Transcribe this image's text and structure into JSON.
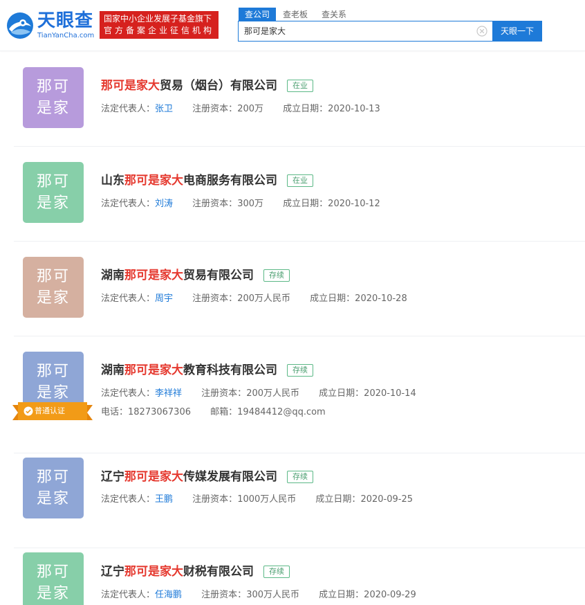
{
  "header": {
    "logo_cn": "天眼查",
    "logo_en": "TianYanCha.com",
    "gov_line1": "国家中小企业发展子基金旗下",
    "gov_line2": "官方备案企业征信机构",
    "tabs": [
      {
        "label": "查公司",
        "active": true
      },
      {
        "label": "查老板",
        "active": false
      },
      {
        "label": "查关系",
        "active": false
      }
    ],
    "search_value": "那可是家大",
    "search_button": "天眼一下",
    "brand_color": "#1e7ad8"
  },
  "labels": {
    "legal_rep": "法定代表人：",
    "capital": "注册资本：",
    "founded": "成立日期：",
    "phone": "电话：",
    "email": "邮箱：",
    "cert": "普通认证"
  },
  "results": [
    {
      "avatar_l1": "那可",
      "avatar_l2": "是家",
      "avatar_color": "#b79bdc",
      "name_pre": "",
      "name_hl": "那可是家大",
      "name_post": "贸易（烟台）有限公司",
      "status": "在业",
      "legal_rep": "张卫",
      "capital": "200万",
      "founded": "2020-10-13"
    },
    {
      "avatar_l1": "那可",
      "avatar_l2": "是家",
      "avatar_color": "#87cfa9",
      "name_pre": "山东",
      "name_hl": "那可是家大",
      "name_post": "电商服务有限公司",
      "status": "在业",
      "legal_rep": "刘涛",
      "capital": "300万",
      "founded": "2020-10-12"
    },
    {
      "avatar_l1": "那可",
      "avatar_l2": "是家",
      "avatar_color": "#d5b0a0",
      "name_pre": "湖南",
      "name_hl": "那可是家大",
      "name_post": "贸易有限公司",
      "status": "存续",
      "legal_rep": "周宇",
      "capital": "200万人民币",
      "founded": "2020-10-28"
    },
    {
      "avatar_l1": "那可",
      "avatar_l2": "是家",
      "avatar_color": "#8fa6d6",
      "name_pre": "湖南",
      "name_hl": "那可是家大",
      "name_post": "教育科技有限公司",
      "status": "存续",
      "legal_rep": "李祥祥",
      "capital": "200万人民币",
      "founded": "2020-10-14",
      "phone": "18273067306",
      "email": "19484412@qq.com",
      "certified": true
    },
    {
      "avatar_l1": "那可",
      "avatar_l2": "是家",
      "avatar_color": "#8fa6d6",
      "name_pre": "辽宁",
      "name_hl": "那可是家大",
      "name_post": "传媒发展有限公司",
      "status": "存续",
      "legal_rep": "王鹏",
      "capital": "1000万人民币",
      "founded": "2020-09-25"
    },
    {
      "avatar_l1": "那可",
      "avatar_l2": "是家",
      "avatar_color": "#87cfa9",
      "name_pre": "辽宁",
      "name_hl": "那可是家大",
      "name_post": "财税有限公司",
      "status": "存续",
      "legal_rep": "任海鹏",
      "capital": "300万人民币",
      "founded": "2020-09-29"
    }
  ]
}
